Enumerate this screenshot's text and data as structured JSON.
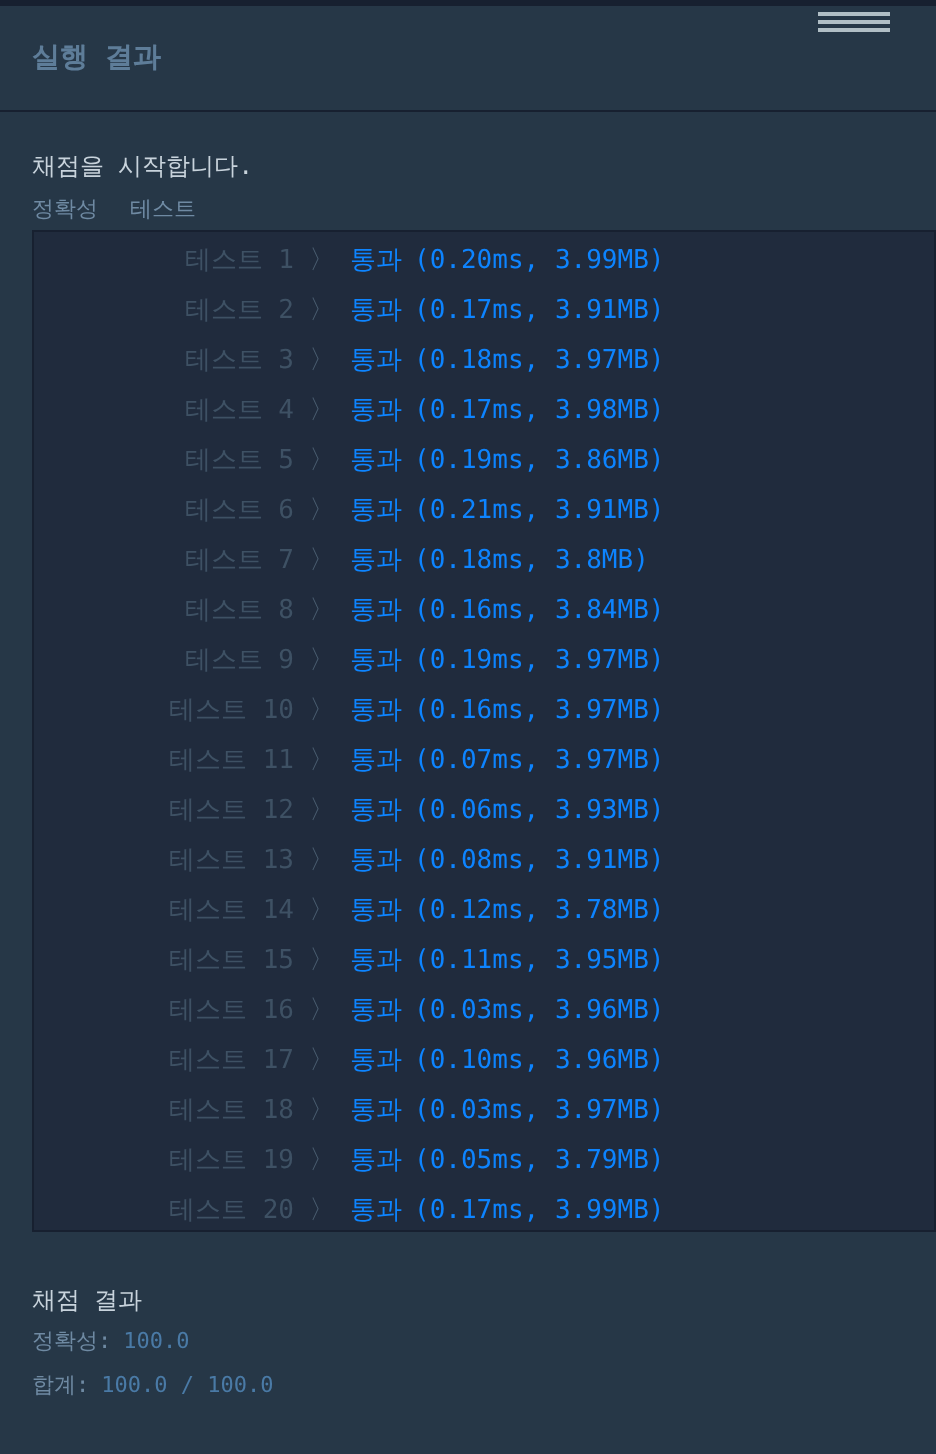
{
  "header": {
    "title": "실행 결과"
  },
  "output": {
    "message": "채점을 시작합니다.",
    "columns": [
      "정확성",
      "테스트"
    ],
    "rows": [
      {
        "label": "테스트 1",
        "separator": "〉",
        "result": "통과",
        "detail": "(0.20ms, 3.99MB)"
      },
      {
        "label": "테스트 2",
        "separator": "〉",
        "result": "통과",
        "detail": "(0.17ms, 3.91MB)"
      },
      {
        "label": "테스트 3",
        "separator": "〉",
        "result": "통과",
        "detail": "(0.18ms, 3.97MB)"
      },
      {
        "label": "테스트 4",
        "separator": "〉",
        "result": "통과",
        "detail": "(0.17ms, 3.98MB)"
      },
      {
        "label": "테스트 5",
        "separator": "〉",
        "result": "통과",
        "detail": "(0.19ms, 3.86MB)"
      },
      {
        "label": "테스트 6",
        "separator": "〉",
        "result": "통과",
        "detail": "(0.21ms, 3.91MB)"
      },
      {
        "label": "테스트 7",
        "separator": "〉",
        "result": "통과",
        "detail": "(0.18ms, 3.8MB)"
      },
      {
        "label": "테스트 8",
        "separator": "〉",
        "result": "통과",
        "detail": "(0.16ms, 3.84MB)"
      },
      {
        "label": "테스트 9",
        "separator": "〉",
        "result": "통과",
        "detail": "(0.19ms, 3.97MB)"
      },
      {
        "label": "테스트 10",
        "separator": "〉",
        "result": "통과",
        "detail": "(0.16ms, 3.97MB)"
      },
      {
        "label": "테스트 11",
        "separator": "〉",
        "result": "통과",
        "detail": "(0.07ms, 3.97MB)"
      },
      {
        "label": "테스트 12",
        "separator": "〉",
        "result": "통과",
        "detail": "(0.06ms, 3.93MB)"
      },
      {
        "label": "테스트 13",
        "separator": "〉",
        "result": "통과",
        "detail": "(0.08ms, 3.91MB)"
      },
      {
        "label": "테스트 14",
        "separator": "〉",
        "result": "통과",
        "detail": "(0.12ms, 3.78MB)"
      },
      {
        "label": "테스트 15",
        "separator": "〉",
        "result": "통과",
        "detail": "(0.11ms, 3.95MB)"
      },
      {
        "label": "테스트 16",
        "separator": "〉",
        "result": "통과",
        "detail": "(0.03ms, 3.96MB)"
      },
      {
        "label": "테스트 17",
        "separator": "〉",
        "result": "통과",
        "detail": "(0.10ms, 3.96MB)"
      },
      {
        "label": "테스트 18",
        "separator": "〉",
        "result": "통과",
        "detail": "(0.03ms, 3.97MB)"
      },
      {
        "label": "테스트 19",
        "separator": "〉",
        "result": "통과",
        "detail": "(0.05ms, 3.79MB)"
      },
      {
        "label": "테스트 20",
        "separator": "〉",
        "result": "통과",
        "detail": "(0.17ms, 3.99MB)"
      }
    ]
  },
  "summary": {
    "title": "채점 결과",
    "lines": [
      {
        "label": "정확성:",
        "value": "100.0"
      },
      {
        "label": "합계:",
        "value": "100.0 / 100.0"
      }
    ]
  }
}
